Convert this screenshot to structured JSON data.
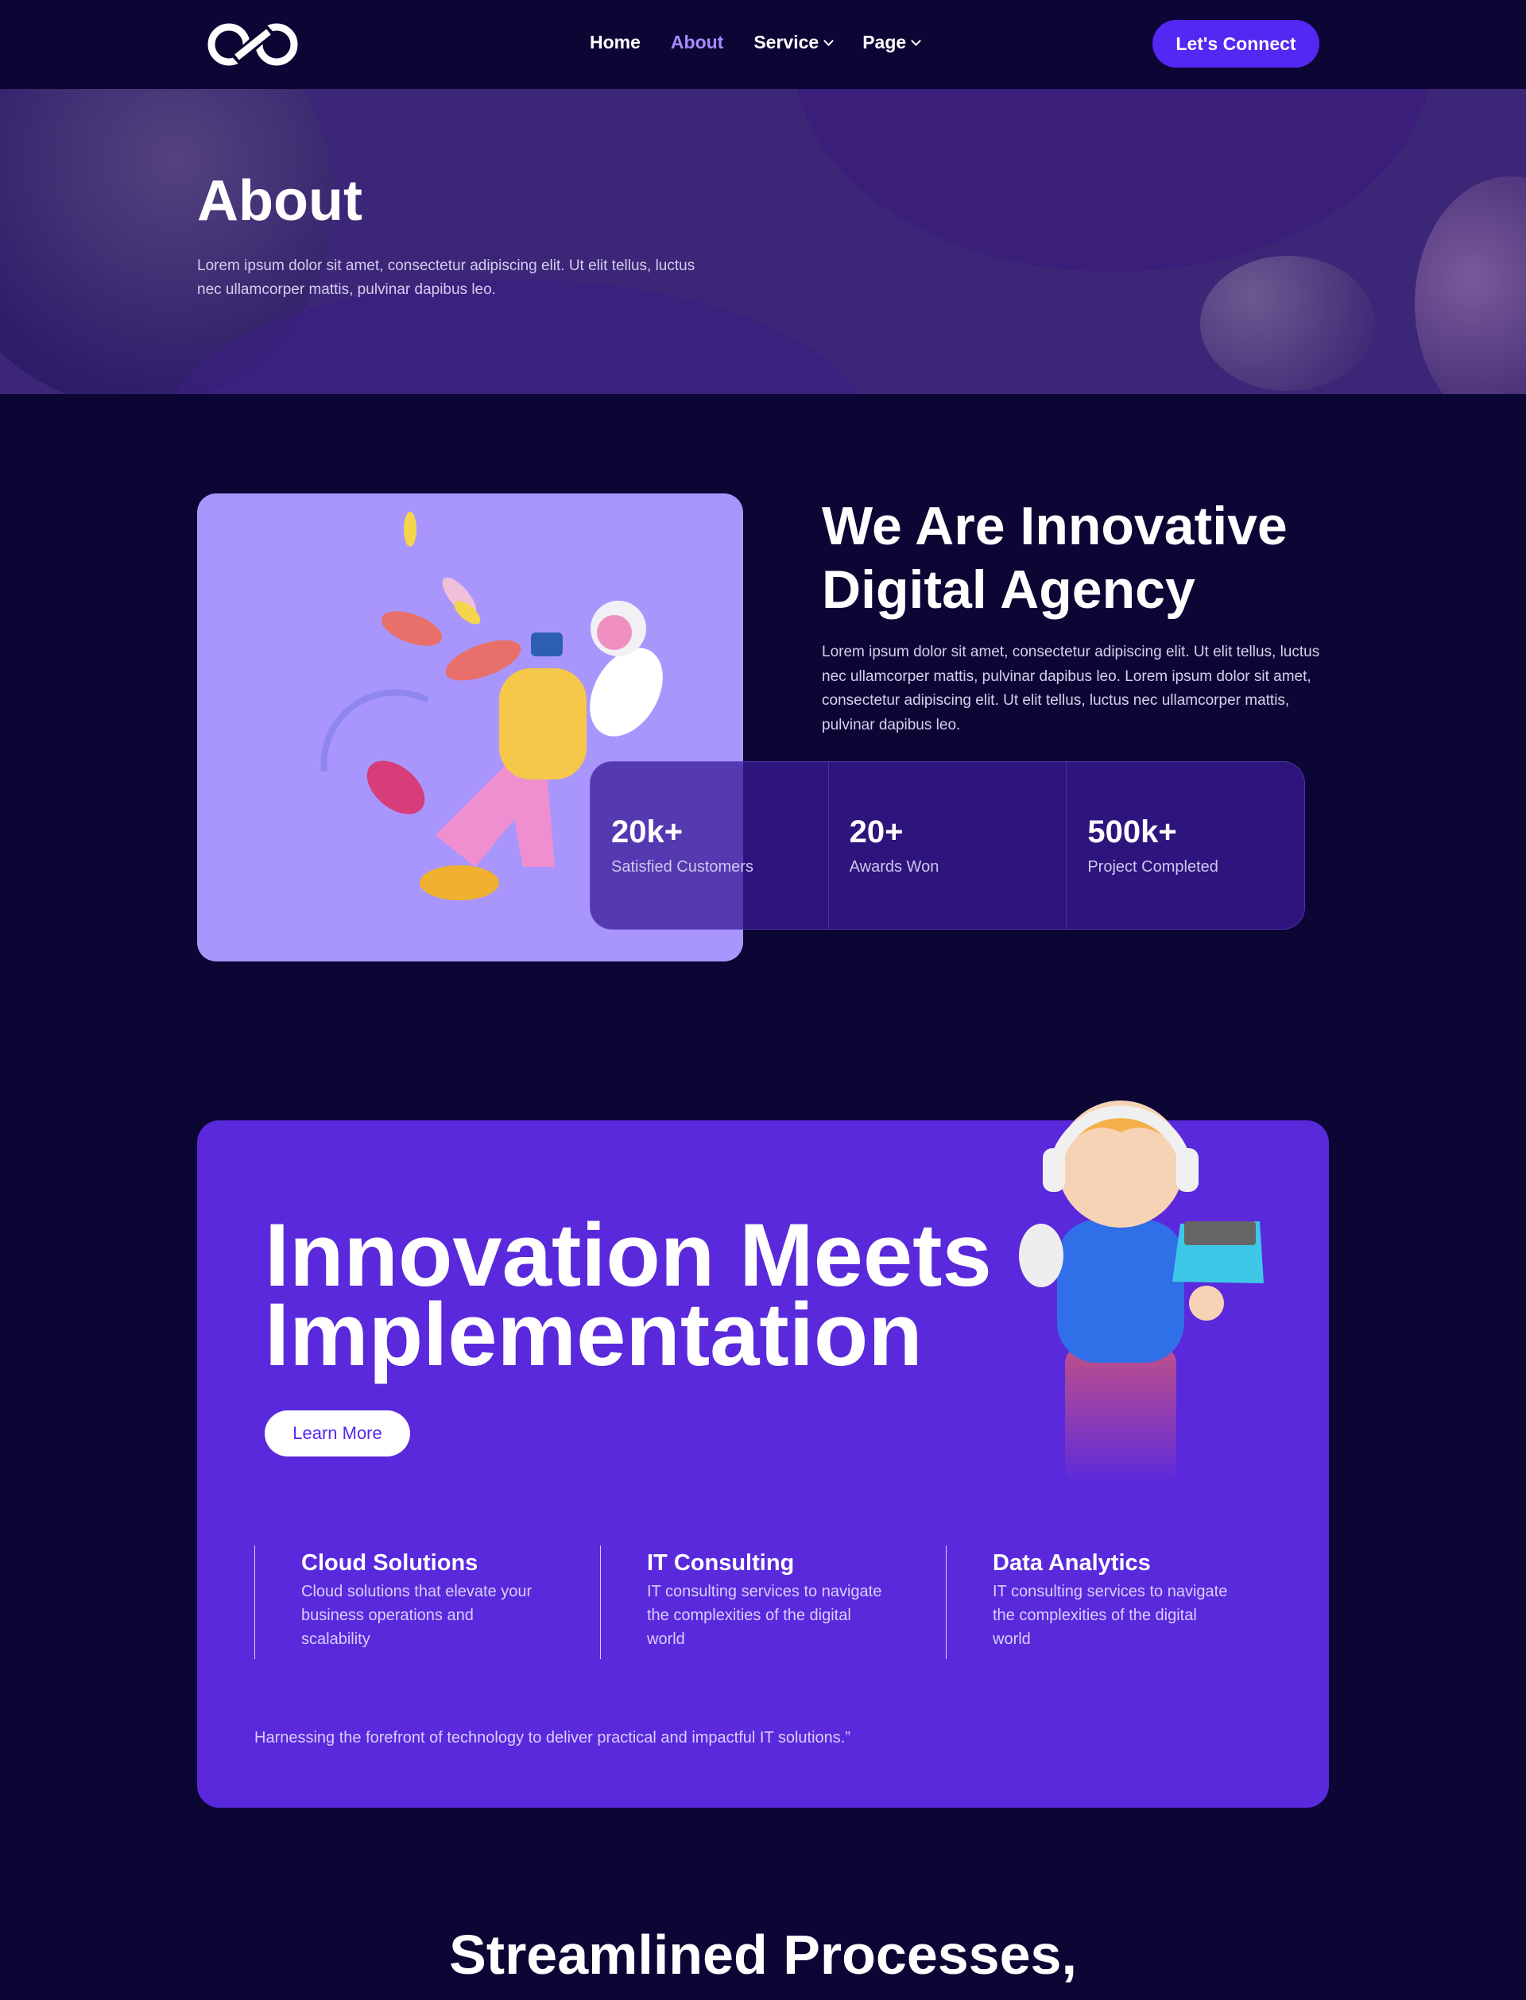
{
  "nav": {
    "logo": "infinity-logo",
    "links": [
      {
        "label": "Home"
      },
      {
        "label": "About",
        "active": true
      },
      {
        "label": "Service"
      },
      {
        "label": "Page"
      }
    ],
    "cta": "Let's Connect"
  },
  "hero": {
    "title": "About",
    "text": "Lorem ipsum dolor sit amet, consectetur adipiscing elit. Ut elit tellus, luctus nec ullamcorper mattis, pulvinar dapibus leo."
  },
  "about": {
    "title": "We Are Innovative Digital Agency",
    "text": "Lorem ipsum dolor sit amet, consectetur adipiscing elit. Ut elit tellus, luctus nec ullamcorper mattis, pulvinar dapibus leo. Lorem ipsum dolor sit amet, consectetur adipiscing elit. Ut elit tellus, luctus nec ullamcorper mattis, pulvinar dapibus leo.",
    "stats": [
      {
        "value": "20k+",
        "label": "Satisfied Customers"
      },
      {
        "value": "20+",
        "label": "Awards Won"
      },
      {
        "value": "500k+",
        "label": "Project Completed"
      }
    ]
  },
  "innovation": {
    "title": "Innovation Meets Implementation",
    "button": "Learn More",
    "features": [
      {
        "title": "Cloud Solutions",
        "text": "Cloud solutions that elevate your business operations and scalability"
      },
      {
        "title": "IT Consulting",
        "text": "IT consulting services to navigate the complexities of the digital world"
      },
      {
        "title": "Data Analytics",
        "text": "IT consulting services to navigate the complexities of the digital world"
      }
    ],
    "quote": "Harnessing the forefront of technology to deliver practical and impactful IT solutions.”"
  },
  "next": {
    "title": "Streamlined Processes,"
  },
  "colors": {
    "bg": "#0c0634",
    "accent": "#5427f2",
    "active_link": "#a68bff",
    "card": "#5a29dc",
    "image_card": "#a996fd"
  }
}
